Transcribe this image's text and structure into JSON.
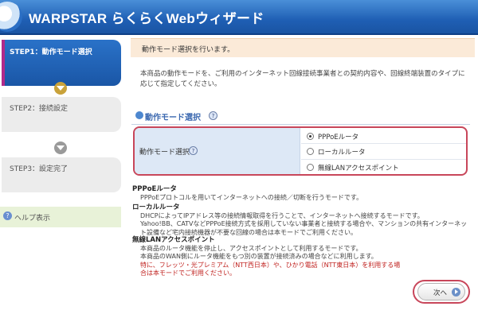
{
  "header": {
    "title": "WARPSTAR らくらくWebウィザード"
  },
  "sidebar": {
    "steps": [
      {
        "label": "STEP1：動作モード選択",
        "state": "active"
      },
      {
        "label": "STEP2：接続設定",
        "state": "inactive"
      },
      {
        "label": "STEP3：設定完了",
        "state": "inactive"
      }
    ],
    "help_label": "ヘルプ表示",
    "help_icon": "?"
  },
  "main": {
    "title": "動作モード選択を行います。",
    "description": "本商品の動作モードを、ご利用のインターネット回線接続事業者との契約内容や、回線終端装置のタイプに応じて指定してください。",
    "section_title": "動作モード選択",
    "section_help": "?",
    "mode_label": "動作モード選択",
    "mode_help": "?",
    "options": [
      {
        "label": "PPPoEルータ",
        "selected": true
      },
      {
        "label": "ローカルルータ",
        "selected": false
      },
      {
        "label": "無線LANアクセスポイント",
        "selected": false
      }
    ],
    "info": [
      {
        "heading": "PPPoEルータ",
        "lines": [
          "PPPoEプロトコルを用いてインターネットへの接続／切断を行うモードです。"
        ]
      },
      {
        "heading": "ローカルルータ",
        "lines": [
          "DHCPによってIPアドレス等の接続情報取得を行うことで、インターネットへ接続するモードです。",
          "Yahoo!BB、CATVなどPPPoE接続方式を採用していない事業者と接続する場合や、マンションの共有インターネット設備など宅内接続機器が不要な回線の場合は本モードでご利用ください。"
        ]
      },
      {
        "heading": "無線LANアクセスポイント",
        "lines": [
          "本商品のルータ機能を停止し、アクセスポイントとして利用するモードです。",
          "本商品のWAN側にルータ機能をもつ別の装置が接続済みの場合などに利用します。"
        ],
        "warning": "特に、フレッツ・光プレミアム（NTT西日本）や、ひかり電話（NTT東日本）を利用する場合は本モードでご利用ください。"
      }
    ],
    "next_label": "次へ"
  },
  "colors": {
    "header": "#1f5fb4",
    "active_step": "#2a72c8",
    "highlight": "#c8465a",
    "title_bar": "#fbead8",
    "warning": "#c0221f"
  },
  "icons": {
    "step_arrow": "chevron-down-icon",
    "next": "arrow-right-icon"
  }
}
